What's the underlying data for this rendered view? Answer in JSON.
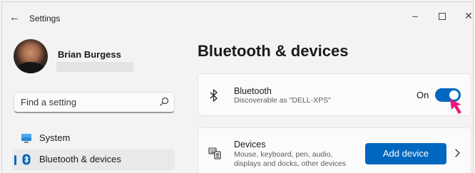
{
  "window": {
    "title": "Settings",
    "back_icon": "←",
    "minimize_icon": "–",
    "close_icon": "✕"
  },
  "profile": {
    "name": "Brian Burgess"
  },
  "search": {
    "placeholder": "Find a setting"
  },
  "nav": {
    "items": [
      {
        "label": "System",
        "icon": "monitor-icon"
      },
      {
        "label": "Bluetooth & devices",
        "icon": "bluetooth-icon",
        "selected": true
      }
    ]
  },
  "main": {
    "title": "Bluetooth & devices",
    "bluetooth": {
      "title": "Bluetooth",
      "subtitle": "Discoverable as \"DELL-XPS\"",
      "state_label": "On",
      "enabled": true
    },
    "devices": {
      "title": "Devices",
      "subtitle_line1": "Mouse, keyboard, pen, audio,",
      "subtitle_line2": "displays and docks, other devices",
      "button_label": "Add device"
    }
  },
  "colors": {
    "accent": "#0067c0",
    "pointer": "#e8197d",
    "background": "#f3f3f3",
    "card": "#fbfbfb"
  }
}
